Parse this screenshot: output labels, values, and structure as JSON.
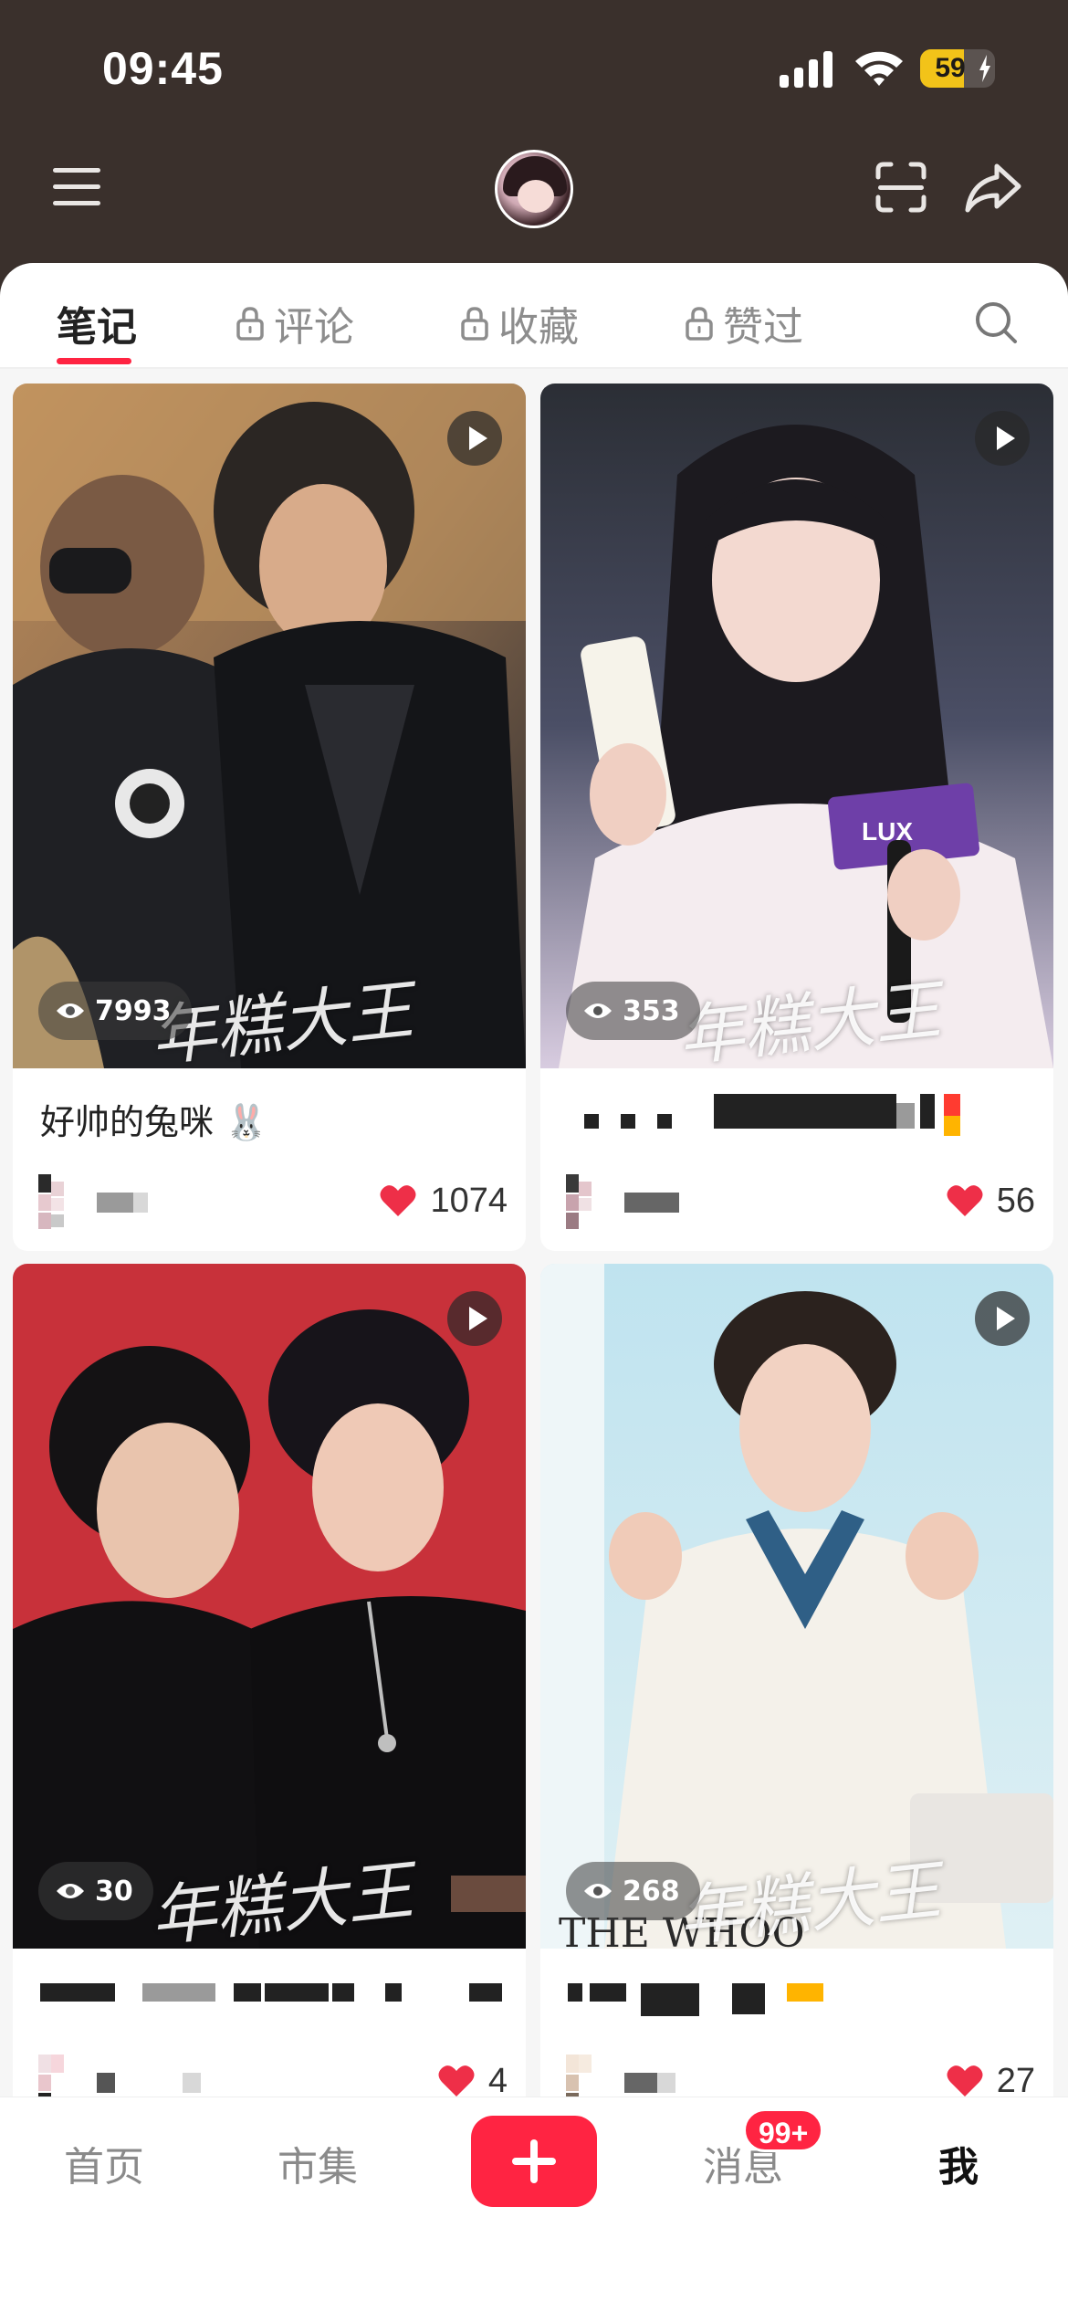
{
  "status_bar": {
    "time": "09:45",
    "battery": "59",
    "battery_level": 0.59
  },
  "tabs": [
    {
      "label": "笔记",
      "locked": false,
      "active": true
    },
    {
      "label": "评论",
      "locked": true,
      "active": false
    },
    {
      "label": "收藏",
      "locked": true,
      "active": false
    },
    {
      "label": "赞过",
      "locked": true,
      "active": false
    }
  ],
  "notes": [
    {
      "title": "好帅的兔咪 🐰",
      "views": "7993",
      "likes": "1074",
      "watermark": "年糕大王"
    },
    {
      "title": "",
      "views": "353",
      "likes": "56",
      "watermark": "年糕大王"
    },
    {
      "title": "",
      "views": "30",
      "likes": "4",
      "watermark": "年糕大王"
    },
    {
      "title": "",
      "views": "268",
      "likes": "27",
      "watermark": "年糕大王",
      "cover_text": "THE WHOO"
    }
  ],
  "bottom_nav": {
    "home": "首页",
    "market": "市集",
    "messages": "消息",
    "messages_badge": "99+",
    "me": "我"
  },
  "colors": {
    "accent": "#ff2442",
    "header_bg": "#3a302c",
    "battery": "#f2c319"
  },
  "icons": [
    "menu-icon",
    "scan-icon",
    "share-icon",
    "lock-icon",
    "search-icon",
    "play-icon",
    "eye-icon",
    "heart-icon",
    "plus-icon"
  ]
}
